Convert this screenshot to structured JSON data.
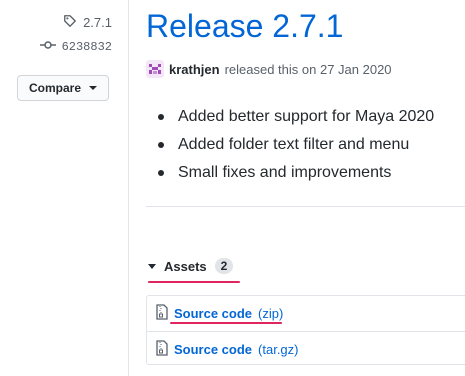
{
  "sidebar": {
    "tag": "2.7.1",
    "commit": "6238832",
    "compare_label": "Compare"
  },
  "release": {
    "title": "Release 2.7.1",
    "author": "krathjen",
    "released_text": "released this on 27 Jan 2020",
    "notes": [
      "Added better support for Maya 2020",
      "Added folder text filter and menu",
      "Small fixes and improvements"
    ]
  },
  "assets": {
    "label": "Assets",
    "count": "2",
    "items": [
      {
        "name": "Source code",
        "ext": "(zip)"
      },
      {
        "name": "Source code",
        "ext": "(tar.gz)"
      }
    ]
  },
  "colors": {
    "link": "#0366d6",
    "annotation_underline": "#e0245e"
  }
}
